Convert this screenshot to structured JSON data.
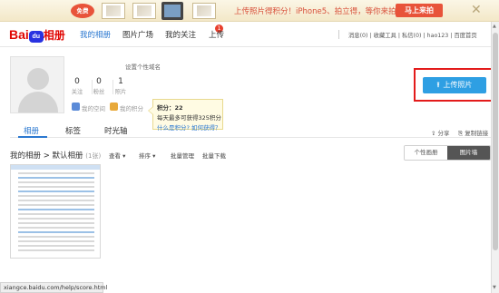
{
  "promo": {
    "free_badge": "免费",
    "message": "上传照片得积分！iPhone5、拍立得，等你来拍！",
    "cta": "马上来拍",
    "close": "✕"
  },
  "nav": {
    "logo_text": "Bai",
    "logo_paw": "du",
    "logo_suffix": "相册",
    "items": [
      "我的相册",
      "图片广场",
      "我的关注",
      "上传"
    ],
    "badge": "1",
    "top_links": [
      "消息(0)",
      "|",
      "收藏工具",
      "|",
      "私信(0)",
      "|",
      "hao123",
      "|",
      "百度首页"
    ]
  },
  "profile": {
    "domain_hint": "设置个性域名",
    "stats": [
      {
        "num": "0",
        "label": "关注"
      },
      {
        "num": "0",
        "label": "粉丝"
      },
      {
        "num": "1",
        "label": "照片"
      }
    ],
    "links": [
      "我的空间",
      "我的积分"
    ]
  },
  "tooltip": {
    "score": "积分：22",
    "daily": "每天最多可获得325积分",
    "help": "什么是积分? 如何获得？"
  },
  "upload_button": "上传照片",
  "tabs": [
    "相册",
    "标签",
    "时光轴"
  ],
  "actions": {
    "share": "分享",
    "copy_link": "复制链接"
  },
  "album": {
    "crumb_root": "我的相册",
    "crumb_sep": ">",
    "crumb_current": "默认相册",
    "count": "(1张)",
    "toolbar": [
      "查看",
      "排序",
      "批量管理",
      "批量下载"
    ],
    "view_options": [
      "个性画册",
      "图片墙"
    ]
  },
  "status_url": "xiangce.baidu.com/help/score.html",
  "colors": {
    "accent": "#2b78d0",
    "upload": "#2e9fe3",
    "highlight": "#e31b1b",
    "promo_red": "#e8533a"
  }
}
